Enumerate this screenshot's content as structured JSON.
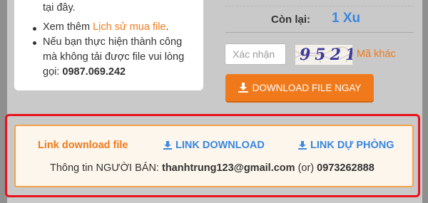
{
  "info_card": {
    "line1": "tại đây.",
    "line2_prefix": "Xem thêm ",
    "line2_link": "Lịch sử mua file",
    "line2_suffix": ".",
    "line3": "Nếu bạn thực hiện thành công",
    "line4": "mà không tải được file vui lòng",
    "line5_prefix": "gọi: ",
    "line5_phone": "0987.069.242"
  },
  "remaining": {
    "label": "Còn lại:",
    "value": "1 Xu"
  },
  "captcha": {
    "placeholder": "Xác nhận",
    "code": "9521",
    "other_label": "Mã khác"
  },
  "download_button": {
    "label": "DOWNLOAD FILE NGAY",
    "icon": "download-icon"
  },
  "links": {
    "title": "Link download file",
    "primary": "LINK DOWNLOAD",
    "backup": "LINK DỰ PHÒNG",
    "seller_prefix": "Thông tin NGƯỜI BÁN: ",
    "seller_email": "thanhtrung123@gmail.com",
    "seller_or": " (or) ",
    "seller_phone": "0973262888"
  },
  "colors": {
    "accent": "#f07a1b",
    "link": "#3a87e0",
    "highlight": "#e8121b"
  }
}
